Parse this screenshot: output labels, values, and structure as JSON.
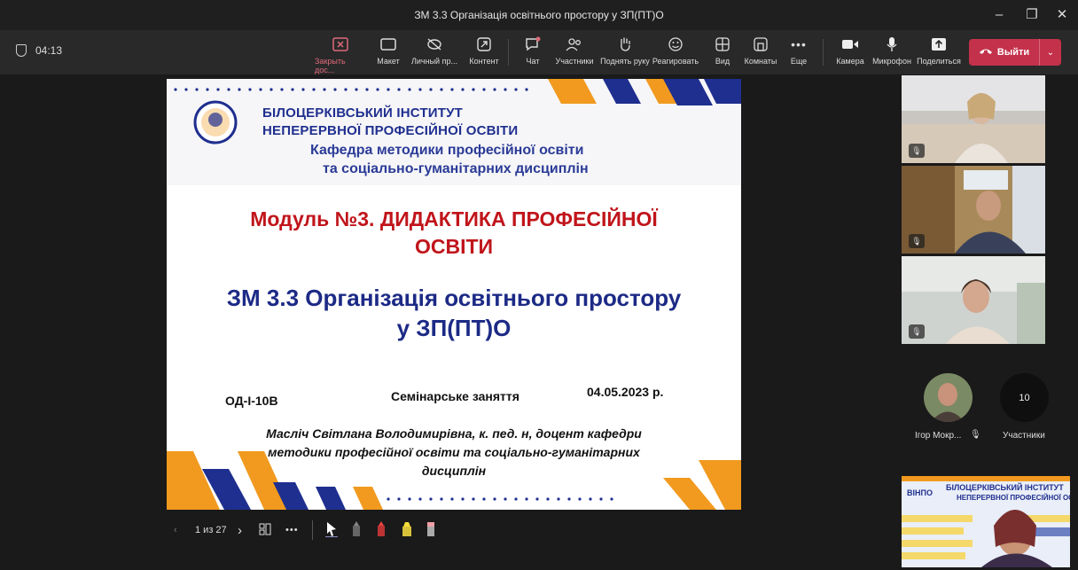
{
  "window": {
    "title": "ЗМ 3.3 Організація освітнього простору у ЗП(ПТ)О",
    "controls": [
      "–",
      "❐",
      "✕"
    ]
  },
  "toolbar": {
    "timer": "04:13",
    "buttons": [
      {
        "label": "Закрыть дос...",
        "icon": "close-share-icon"
      },
      {
        "label": "Макет",
        "icon": "layout-icon"
      },
      {
        "label": "Личный пр...",
        "icon": "private-view-icon"
      },
      {
        "label": "Контент",
        "icon": "content-icon"
      },
      {
        "label": "Чат",
        "icon": "chat-icon"
      },
      {
        "label": "Участники",
        "icon": "participants-icon"
      },
      {
        "label": "Поднять руку",
        "icon": "raise-hand-icon"
      },
      {
        "label": "Реагировать",
        "icon": "react-icon"
      },
      {
        "label": "Вид",
        "icon": "view-icon"
      },
      {
        "label": "Комнаты",
        "icon": "rooms-icon"
      },
      {
        "label": "Еще",
        "icon": "more-icon"
      },
      {
        "label": "Камера",
        "icon": "camera-icon"
      },
      {
        "label": "Микрофон",
        "icon": "microphone-icon"
      },
      {
        "label": "Поделиться",
        "icon": "share-icon"
      }
    ],
    "leave": "Выйти",
    "accent": "#c4314b"
  },
  "slide": {
    "institute_line1": "БІЛОЦЕРКІВСЬКИЙ ІНСТИТУТ",
    "institute_line2": "НЕПЕРЕРВНОЇ ПРОФЕСІЙНОЇ ОСВІТИ",
    "department_line1": "Кафедра методики професійної освіти",
    "department_line2": "та соціально-гуманітарних дисциплін",
    "module_line1": "Модуль №3. ДИДАКТИКА ПРОФЕСІЙНОЇ",
    "module_line2": "ОСВІТИ",
    "topic_line1": "ЗМ 3.3 Організація освітнього простору",
    "topic_line2": "у ЗП(ПТ)О",
    "group": "ОД-І-10В",
    "lesson_type": "Семінарське заняття",
    "date": "04.05.2023 р.",
    "author_line1": "Масліч Світлана Володимирівна, к. пед. н, доцент кафедри",
    "author_line2": "методики професійної освіти та соціально-гуманітарних",
    "author_line3": "дисциплін",
    "colors": {
      "navy": "#1f2f8f",
      "red": "#c0151b",
      "orange": "#f19a1f"
    }
  },
  "slide_controls": {
    "page": "1 из 27",
    "tools": [
      "pointer-icon",
      "pen-dark-icon",
      "pen-red-icon",
      "highlighter-yellow-icon",
      "eraser-icon"
    ]
  },
  "participants": {
    "person_name": "Ігор Мокр...",
    "count": "10",
    "count_label": "Участники"
  },
  "thumbnail": {
    "logo": "ВІНПО",
    "line1": "БІЛОЦЕРКІВСЬКИЙ ІНСТИТУТ",
    "line2": "НЕПЕРЕРВНОЇ ПРОФЕСІЙНОЇ ОСВІТИ"
  }
}
